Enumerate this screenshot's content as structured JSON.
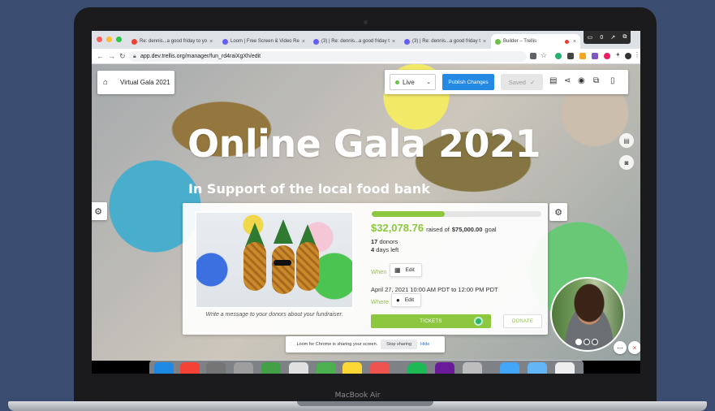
{
  "device": {
    "label": "MacBook Air"
  },
  "browser": {
    "tabs": [
      {
        "label": "Re: dennis...a good friday to yo",
        "favicon_color": "#ea4335",
        "icon": "gmail-icon"
      },
      {
        "label": "Loom | Free Screen & Video Re",
        "favicon_color": "#625df5",
        "icon": "loom-icon"
      },
      {
        "label": "(3) | Re: dennis...a good friday t",
        "favicon_color": "#625df5",
        "icon": "loom-icon"
      },
      {
        "label": "(3) | Re: dennis...a good friday t",
        "favicon_color": "#625df5",
        "icon": "loom-icon"
      },
      {
        "label": "Builder – Trellis",
        "favicon_color": "#6cc04a",
        "icon": "trellis-icon",
        "active": true
      }
    ],
    "url": "app.dev.trellis.org/manager/fun_rd4raiXgXh/edit"
  },
  "loom_toolbar": {
    "count": "0"
  },
  "builder": {
    "event_name": "Virtual Gala 2021",
    "status": "Live",
    "publish_label": "Publish Changes",
    "saved_label": "Saved"
  },
  "hero": {
    "title": "Online Gala 2021",
    "subtitle": "In Support of the local food bank"
  },
  "fundraiser": {
    "progress": 0.43,
    "amount_raised": "$32,078.76",
    "raised_of": "raised of",
    "goal": "$75,000.00",
    "goal_suffix": "goal",
    "donors_count": "17",
    "donors_label": "donors",
    "days_count": "4",
    "days_label": "days left",
    "when_label": "When",
    "edit_label": "Edit",
    "date_range": "April 27, 2021 10:00 AM PDT to 12:00 PM PDT",
    "where_label": "Where",
    "caption": "Write a message to your donors about your fundraiser.",
    "tickets_label": "TICKETS",
    "donate_label": "DONATE"
  },
  "loom_notice": {
    "message": "Loom for Chrome is sharing your screen.",
    "stop_label": "Stop sharing",
    "hide_label": "Hide"
  },
  "colors": {
    "accent_green": "#8dc63f",
    "publish_blue": "#2489e3",
    "page_bg": "#3a4c70"
  }
}
